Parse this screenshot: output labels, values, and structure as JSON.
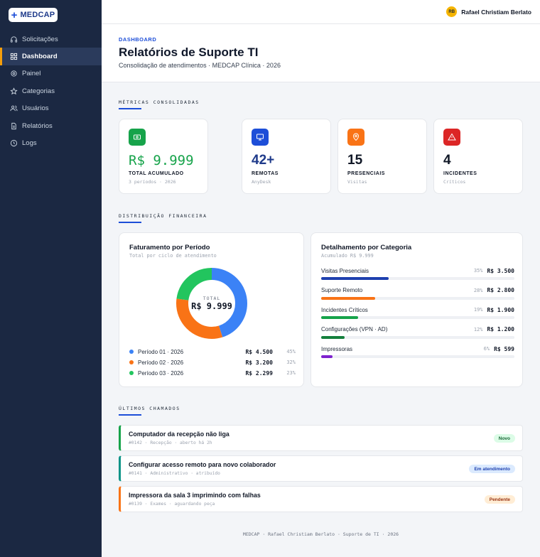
{
  "brand": {
    "logo_symbol": "+",
    "logo_text": "MEDCAP"
  },
  "sidebar": {
    "items": [
      {
        "label": "Solicitações",
        "icon": "headset-icon",
        "active": false
      },
      {
        "label": "Dashboard",
        "icon": "grid-icon",
        "active": true
      },
      {
        "label": "Painel",
        "icon": "gear-icon",
        "active": false
      },
      {
        "label": "Categorias",
        "icon": "star-icon",
        "active": false
      },
      {
        "label": "Usuários",
        "icon": "users-icon",
        "active": false
      },
      {
        "label": "Relatórios",
        "icon": "file-icon",
        "active": false
      },
      {
        "label": "Logs",
        "icon": "clock-icon",
        "active": false
      }
    ]
  },
  "user": {
    "initials": "RB",
    "name": "Rafael Christiam Berlato"
  },
  "header": {
    "eyebrow": "DASHBOARD",
    "title": "Relatórios de Suporte TI",
    "subtitle": "Consolidação de atendimentos · MEDCAP Clínica · 2026"
  },
  "sections": {
    "metrics": "MÉTRICAS CONSOLIDADAS",
    "finance": "DISTRIBUIÇÃO FINANCEIRA",
    "tickets": "ÚLTIMOS CHAMADOS"
  },
  "metrics": [
    {
      "value": "R$ 9.999",
      "label": "TOTAL ACUMULADO",
      "sub": "3 períodos · 2026",
      "icon": "cash-icon",
      "color": "#16a34a",
      "value_color": "#16a34a"
    },
    {
      "value": "42+",
      "label": "REMOTAS",
      "sub": "AnyDesk",
      "icon": "monitor-icon",
      "color": "#1d4ed8",
      "value_color": "#1e3a8a"
    },
    {
      "value": "15",
      "label": "PRESENCIAIS",
      "sub": "Visitas",
      "icon": "location-pin-icon",
      "color": "#f97316",
      "value_color": "#111827"
    },
    {
      "value": "4",
      "label": "INCIDENTES",
      "sub": "Críticos",
      "icon": "warning-icon",
      "color": "#dc2626",
      "value_color": "#111827"
    }
  ],
  "revenue": {
    "title": "Faturamento por Período",
    "subtitle": "Total por ciclo de atendimento",
    "center_label": "TOTAL",
    "center_value": "R$ 9.999"
  },
  "breakdown": {
    "title": "Detalhamento por Categoria",
    "subtitle": "Acumulado R$ 9.999"
  },
  "chart_data": [
    {
      "type": "pie",
      "title": "Faturamento por Período",
      "categories": [
        "Período 01 · 2026",
        "Período 02 · 2026",
        "Período 03 · 2026"
      ],
      "values": [
        4500,
        3200,
        2299
      ],
      "value_labels": [
        "R$ 4.500",
        "R$ 3.200",
        "R$ 2.299"
      ],
      "percent_labels": [
        "45%",
        "32%",
        "23%"
      ],
      "colors": [
        "#3b82f6",
        "#f97316",
        "#22c55e"
      ]
    },
    {
      "type": "bar",
      "title": "Detalhamento por Categoria",
      "categories": [
        "Visitas Presenciais",
        "Suporte Remoto",
        "Incidentes Críticos",
        "Configurações (VPN · AD)",
        "Impressoras"
      ],
      "values": [
        3500,
        2800,
        1900,
        1200,
        599
      ],
      "value_labels": [
        "R$ 3.500",
        "R$ 2.800",
        "R$ 1.900",
        "R$ 1.200",
        "R$ 599"
      ],
      "percent": [
        35,
        28,
        19,
        12,
        6
      ],
      "percent_labels": [
        "35%",
        "28%",
        "19%",
        "12%",
        "6%"
      ],
      "colors": [
        "#1e40af",
        "#f97316",
        "#16a34a",
        "#15803d",
        "#7e22ce"
      ]
    }
  ],
  "tickets": [
    {
      "title": "Computador da recepção não liga",
      "meta": "#0142 · Recepção · aberto há 2h",
      "badge": "Novo",
      "accent": "#16a34a",
      "badge_bg": "#dcfce7",
      "badge_fg": "#166534"
    },
    {
      "title": "Configurar acesso remoto para novo colaborador",
      "meta": "#0141 · Administrativo · atribuído",
      "badge": "Em atendimento",
      "accent": "#0d9488",
      "badge_bg": "#dbeafe",
      "badge_fg": "#1e40af"
    },
    {
      "title": "Impressora da sala 3 imprimindo com falhas",
      "meta": "#0139 · Exames · aguardando peça",
      "badge": "Pendente",
      "accent": "#f97316",
      "badge_bg": "#ffedd5",
      "badge_fg": "#9a3412"
    }
  ],
  "footer": "MEDCAP · Rafael Christiam Berlato · Suporte de TI · 2026"
}
